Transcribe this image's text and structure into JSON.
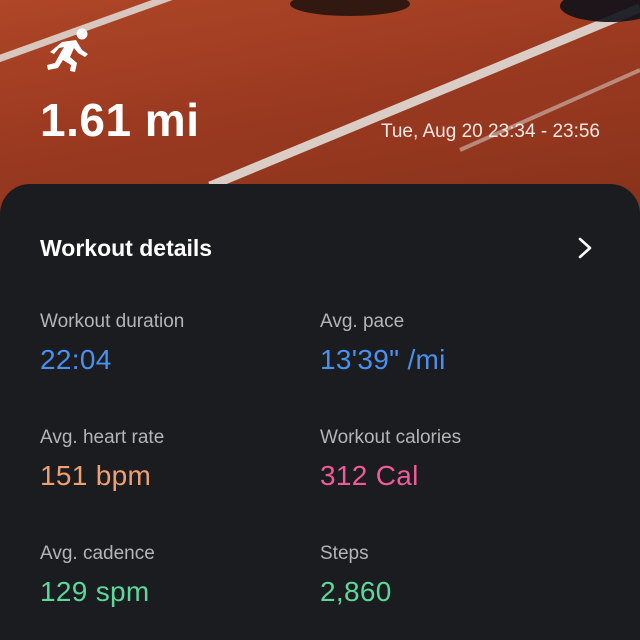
{
  "hero": {
    "activity_icon": "running-person-icon",
    "distance": "1.61 mi",
    "date_range": "Tue, Aug 20 23:34 - 23:56"
  },
  "card": {
    "title": "Workout details",
    "chevron_icon": "chevron-right-icon",
    "metrics": [
      {
        "label": "Workout duration",
        "value": "22:04",
        "color": "#4a90f0"
      },
      {
        "label": "Avg. pace",
        "value": "13'39\" /mi",
        "color": "#4a90f0"
      },
      {
        "label": "Avg. heart rate",
        "value": "151 bpm",
        "color": "#f0a070"
      },
      {
        "label": "Workout calories",
        "value": "312 Cal",
        "color": "#ef5a9a"
      },
      {
        "label": "Avg. cadence",
        "value": "129 spm",
        "color": "#5cd89a"
      },
      {
        "label": "Steps",
        "value": "2,860",
        "color": "#5cd89a"
      }
    ]
  },
  "colors": {
    "track": "#a8401f",
    "card_background": "#1b1c1f",
    "label_gray": "#b5b5b8"
  }
}
